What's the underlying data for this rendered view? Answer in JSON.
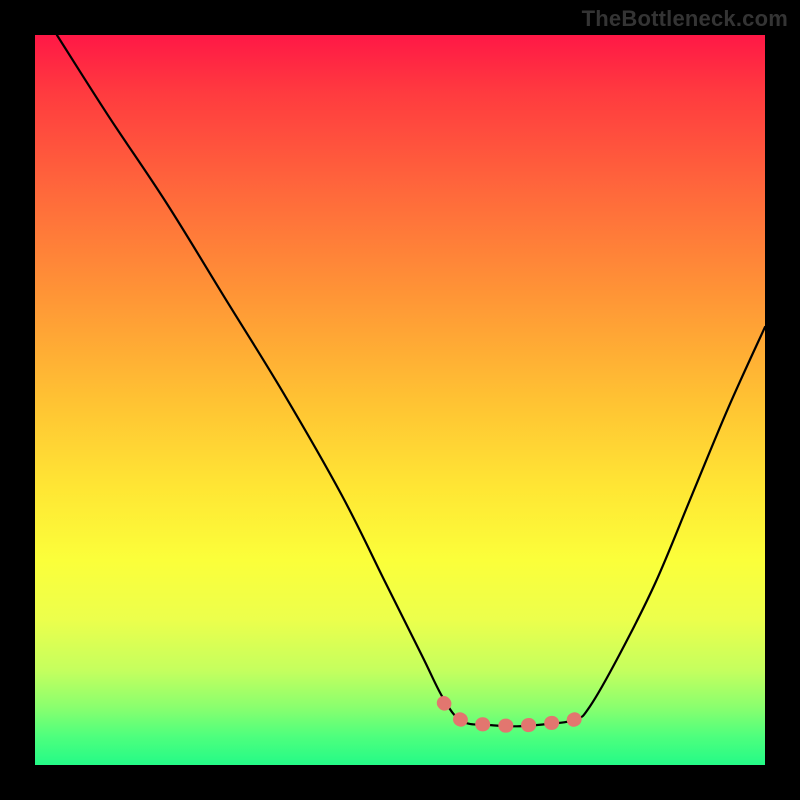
{
  "watermark": "TheBottleneck.com",
  "chart_data": {
    "type": "line",
    "title": "",
    "xlabel": "",
    "ylabel": "",
    "xlim": [
      0,
      100
    ],
    "ylim": [
      0,
      100
    ],
    "colors": {
      "gradient_top": "#ff1846",
      "gradient_bottom": "#24fa87",
      "frame": "#000000",
      "main_curve": "#000000",
      "marker_curve": "#e2766f"
    },
    "series": [
      {
        "name": "main_curve",
        "x": [
          3,
          10,
          18,
          26,
          34,
          42,
          48,
          53,
          56,
          58.5,
          62,
          66,
          70,
          74,
          76,
          80,
          85,
          90,
          95,
          100
        ],
        "y": [
          100,
          89,
          77,
          64,
          51,
          37,
          25,
          15,
          9,
          6,
          5.5,
          5.3,
          5.6,
          6.2,
          8,
          15,
          25,
          37,
          49,
          60
        ]
      },
      {
        "name": "flat_markers",
        "x": [
          56,
          58,
          60,
          62,
          64,
          66,
          68,
          70,
          72,
          74,
          76
        ],
        "y": [
          8.5,
          6.4,
          5.8,
          5.5,
          5.4,
          5.4,
          5.5,
          5.7,
          5.9,
          6.3,
          8.2
        ]
      }
    ]
  }
}
